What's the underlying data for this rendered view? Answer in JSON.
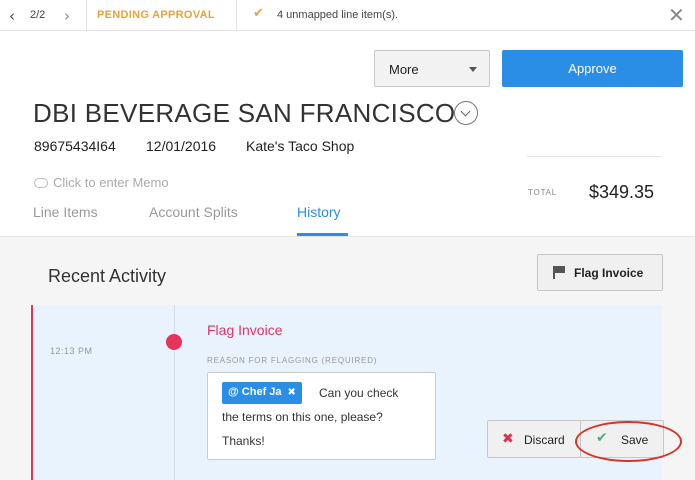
{
  "topbar": {
    "prev_icon": "chevron-left-icon",
    "pager": "2/2",
    "next_icon": "chevron-right-icon",
    "status": "PENDING APPROVAL",
    "status_color": "#e8a33a",
    "warning_icon": "check-icon",
    "unmapped": "4 unmapped line item(s).",
    "close_icon": "close-icon"
  },
  "actions": {
    "more_label": "More",
    "approve_label": "Approve",
    "accent_color": "#2b8ee6"
  },
  "invoice": {
    "vendor": "DBI BEVERAGE SAN FRANCISCO",
    "number": "89675434I64",
    "date": "12/01/2016",
    "location": "Kate's Taco Shop",
    "memo_placeholder": "Click to enter Memo",
    "total_label": "TOTAL",
    "total_value": "$349.35"
  },
  "tabs": [
    {
      "label": "Line Items"
    },
    {
      "label": "Account Splits"
    },
    {
      "label": "History",
      "active": true
    }
  ],
  "history": {
    "title": "Recent Activity",
    "flag_button": "Flag Invoice",
    "activity": {
      "time": "12:13 PM",
      "title": "Flag Invoice",
      "title_color": "#e4345c",
      "reason_label": "REASON FOR FLAGGING (REQUIRED)",
      "mention": "@ Chef Ja",
      "comment_line1": "Can you check",
      "comment_line2": "the terms on this one, please?",
      "comment_line3": "Thanks!",
      "discard_label": "Discard",
      "save_label": "Save"
    }
  }
}
